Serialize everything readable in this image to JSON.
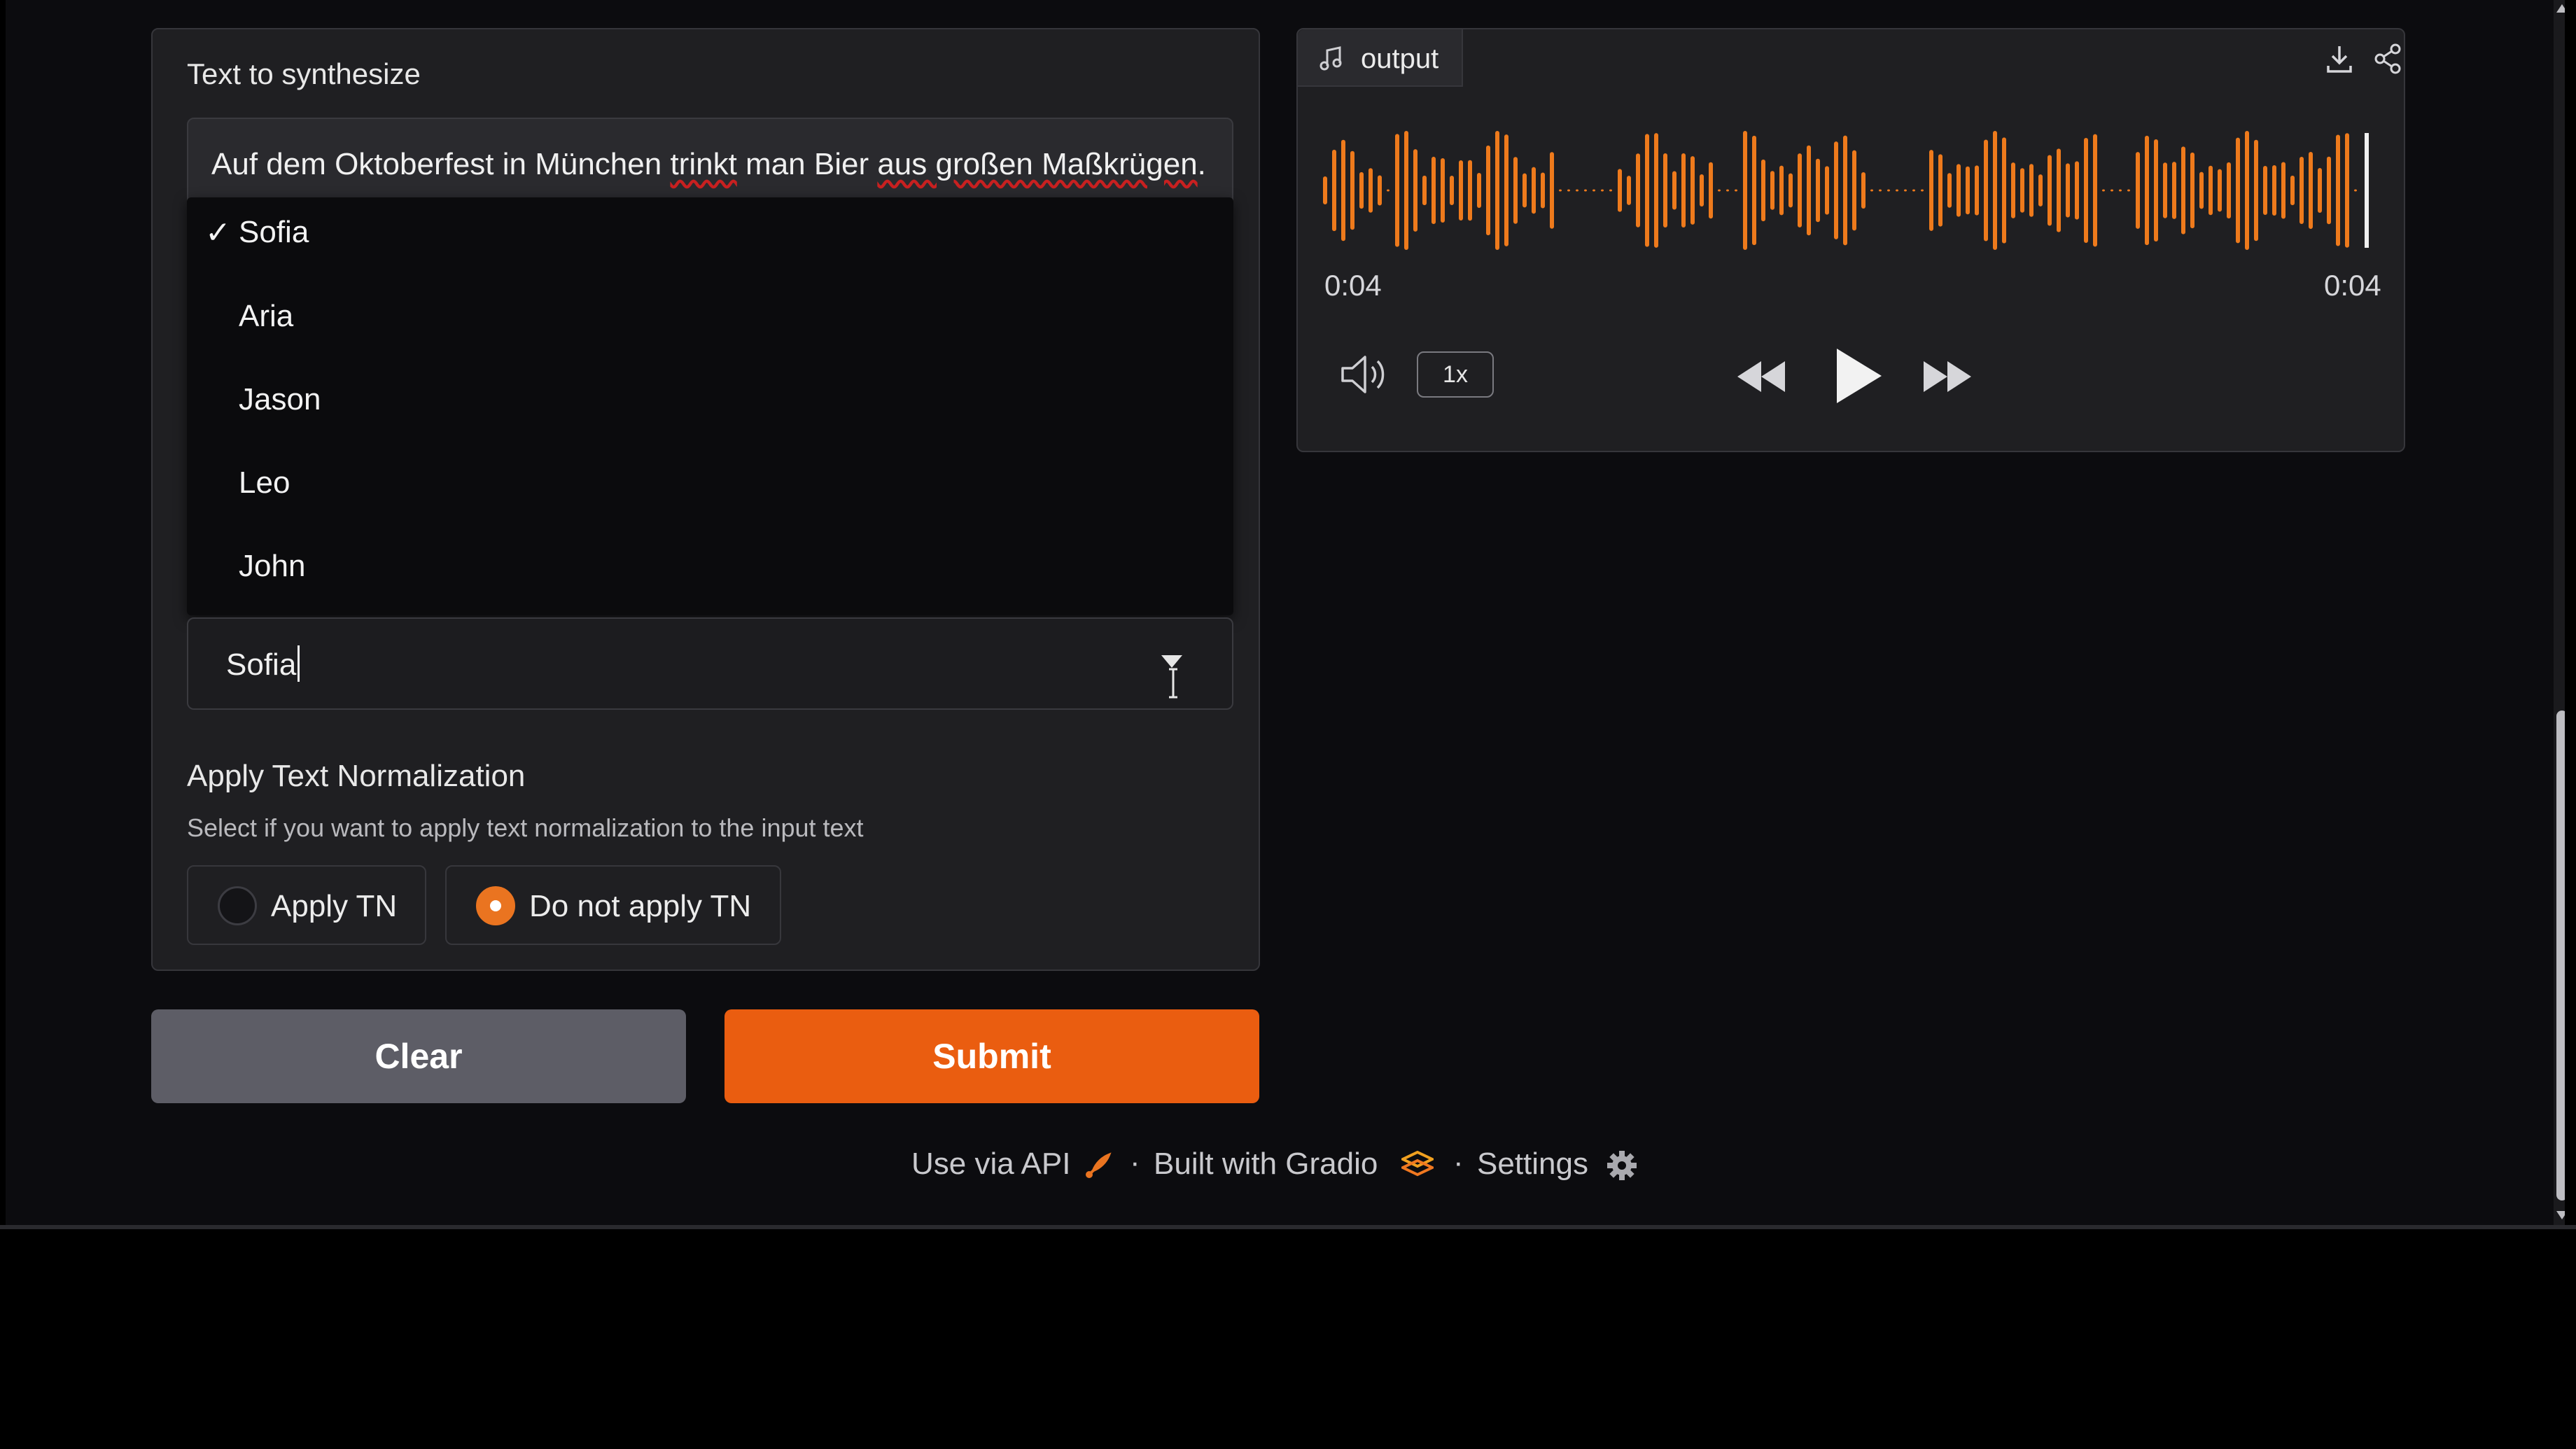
{
  "input": {
    "text_label": "Text to synthesize",
    "text_value_parts": [
      "Auf dem Oktoberfest in München ",
      "trinkt",
      " man Bier ",
      "aus großen Maßkrügen",
      "."
    ],
    "voice_options": [
      "Sofia",
      "Aria",
      "Jason",
      "Leo",
      "John"
    ],
    "voice_selected_check": "✓",
    "voice_selected": "Sofia",
    "tn_title": "Apply Text Normalization",
    "tn_description": "Select if you want to apply text normalization to the input text",
    "tn_options": [
      "Apply TN",
      "Do not apply TN"
    ],
    "tn_selected_index": 1
  },
  "actions": {
    "clear_label": "Clear",
    "submit_label": "Submit"
  },
  "output": {
    "tab_label": "output",
    "time_current": "0:04",
    "time_total": "0:04",
    "speed": "1x"
  },
  "footer": {
    "api": "Use via API",
    "built": "Built with Gradio",
    "settings": "Settings",
    "separator": "·"
  },
  "colors": {
    "accent": "#ea5d10",
    "waveform": "#ee7a1c",
    "panel_bg": "#1f1f22",
    "page_bg": "#0c0c0f"
  }
}
